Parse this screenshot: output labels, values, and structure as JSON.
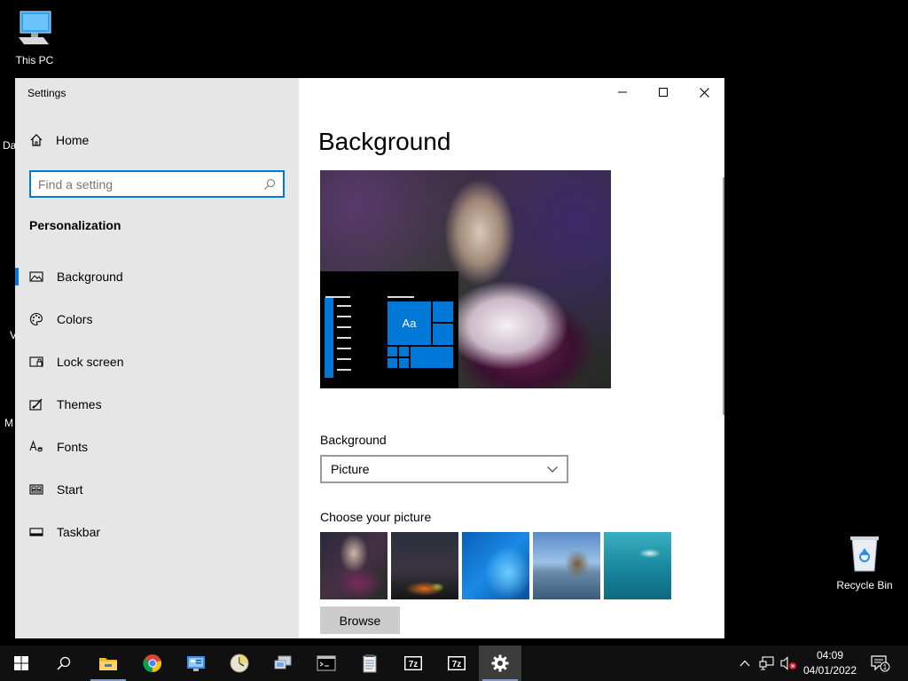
{
  "desktop": {
    "icons": [
      {
        "label": "This PC"
      },
      {
        "label": "Recycle Bin"
      }
    ],
    "clipped_labels": [
      "Da",
      "V",
      "M"
    ]
  },
  "window": {
    "title": "Settings",
    "sidebar": {
      "home_label": "Home",
      "search_placeholder": "Find a setting",
      "section_title": "Personalization",
      "items": [
        {
          "label": "Background",
          "icon": "picture-icon",
          "active": true
        },
        {
          "label": "Colors",
          "icon": "palette-icon",
          "active": false
        },
        {
          "label": "Lock screen",
          "icon": "lock-screen-icon",
          "active": false
        },
        {
          "label": "Themes",
          "icon": "themes-icon",
          "active": false
        },
        {
          "label": "Fonts",
          "icon": "fonts-icon",
          "active": false
        },
        {
          "label": "Start",
          "icon": "start-icon",
          "active": false
        },
        {
          "label": "Taskbar",
          "icon": "taskbar-icon",
          "active": false
        }
      ]
    },
    "main": {
      "title": "Background",
      "preview_tile_label": "Aa",
      "background_label": "Background",
      "background_value": "Picture",
      "choose_label": "Choose your picture",
      "browse_label": "Browse"
    }
  },
  "taskbar": {
    "time": "04:09",
    "date": "04/01/2022",
    "notification_count": "1",
    "apps": [
      "file-explorer-icon",
      "chrome-icon",
      "control-panel-icon",
      "clock-app-icon",
      "network-app-icon",
      "terminal-icon",
      "notepad-icon",
      "7zip-icon",
      "7zip-icon",
      "settings-icon"
    ]
  },
  "colors": {
    "accent": "#0078d7",
    "sidebar_bg": "#e6e6e6",
    "taskbar_bg": "#101010"
  }
}
